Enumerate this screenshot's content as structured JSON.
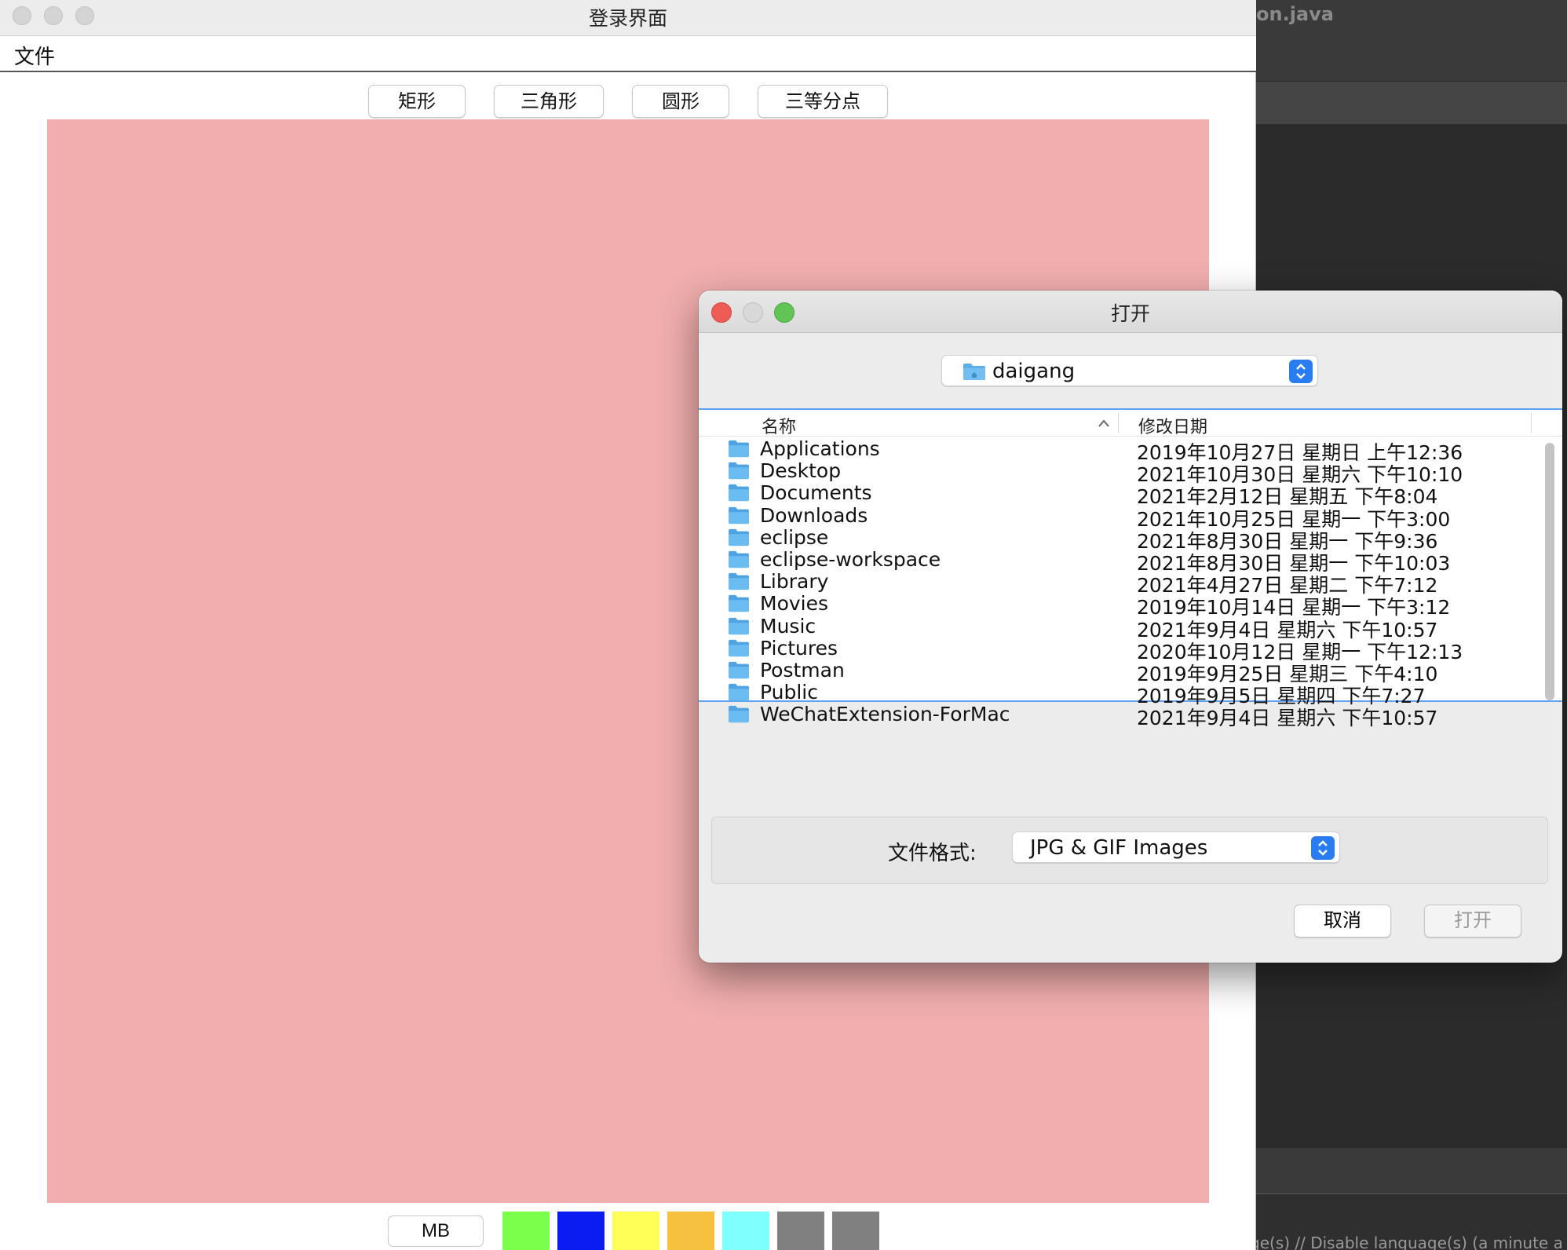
{
  "ide": {
    "file_title": "on.java",
    "status_text": "ge(s) // Disable language(s) (a minute a"
  },
  "main_window": {
    "title": "登录界面",
    "menu": {
      "file": "文件"
    },
    "shape_buttons": [
      {
        "label": "矩形"
      },
      {
        "label": "三角形"
      },
      {
        "label": "圆形"
      },
      {
        "label": "三等分点"
      }
    ],
    "canvas_color": "#f2aeae",
    "mb_label": "MB",
    "swatches": [
      "#7bff4a",
      "#0a1cf2",
      "#ffff57",
      "#f7c140",
      "#80ffff",
      "#808080",
      "#808080"
    ]
  },
  "dialog": {
    "title": "打开",
    "location": "daigang",
    "columns": {
      "name": "名称",
      "date": "修改日期"
    },
    "files": [
      {
        "name": "Applications",
        "date": "2019年10月27日 星期日 上午12:36"
      },
      {
        "name": "Desktop",
        "date": "2021年10月30日 星期六 下午10:10"
      },
      {
        "name": "Documents",
        "date": "2021年2月12日 星期五 下午8:04"
      },
      {
        "name": "Downloads",
        "date": "2021年10月25日 星期一 下午3:00"
      },
      {
        "name": "eclipse",
        "date": "2021年8月30日 星期一 下午9:36"
      },
      {
        "name": "eclipse-workspace",
        "date": "2021年8月30日 星期一 下午10:03"
      },
      {
        "name": "Library",
        "date": "2021年4月27日 星期二 下午7:12"
      },
      {
        "name": "Movies",
        "date": "2019年10月14日 星期一 下午3:12"
      },
      {
        "name": "Music",
        "date": "2021年9月4日 星期六 下午10:57"
      },
      {
        "name": "Pictures",
        "date": "2020年10月12日 星期一 下午12:13"
      },
      {
        "name": "Postman",
        "date": "2019年9月25日 星期三 下午4:10"
      },
      {
        "name": "Public",
        "date": "2019年9月5日 星期四 下午7:27"
      },
      {
        "name": "WeChatExtension-ForMac",
        "date": "2021年9月4日 星期六 下午10:57"
      }
    ],
    "filter_label": "文件格式:",
    "filter_value": "JPG & GIF Images",
    "cancel_label": "取消",
    "open_label": "打开",
    "accent": "#2a7df1",
    "folder_color": "#5aaeea"
  }
}
